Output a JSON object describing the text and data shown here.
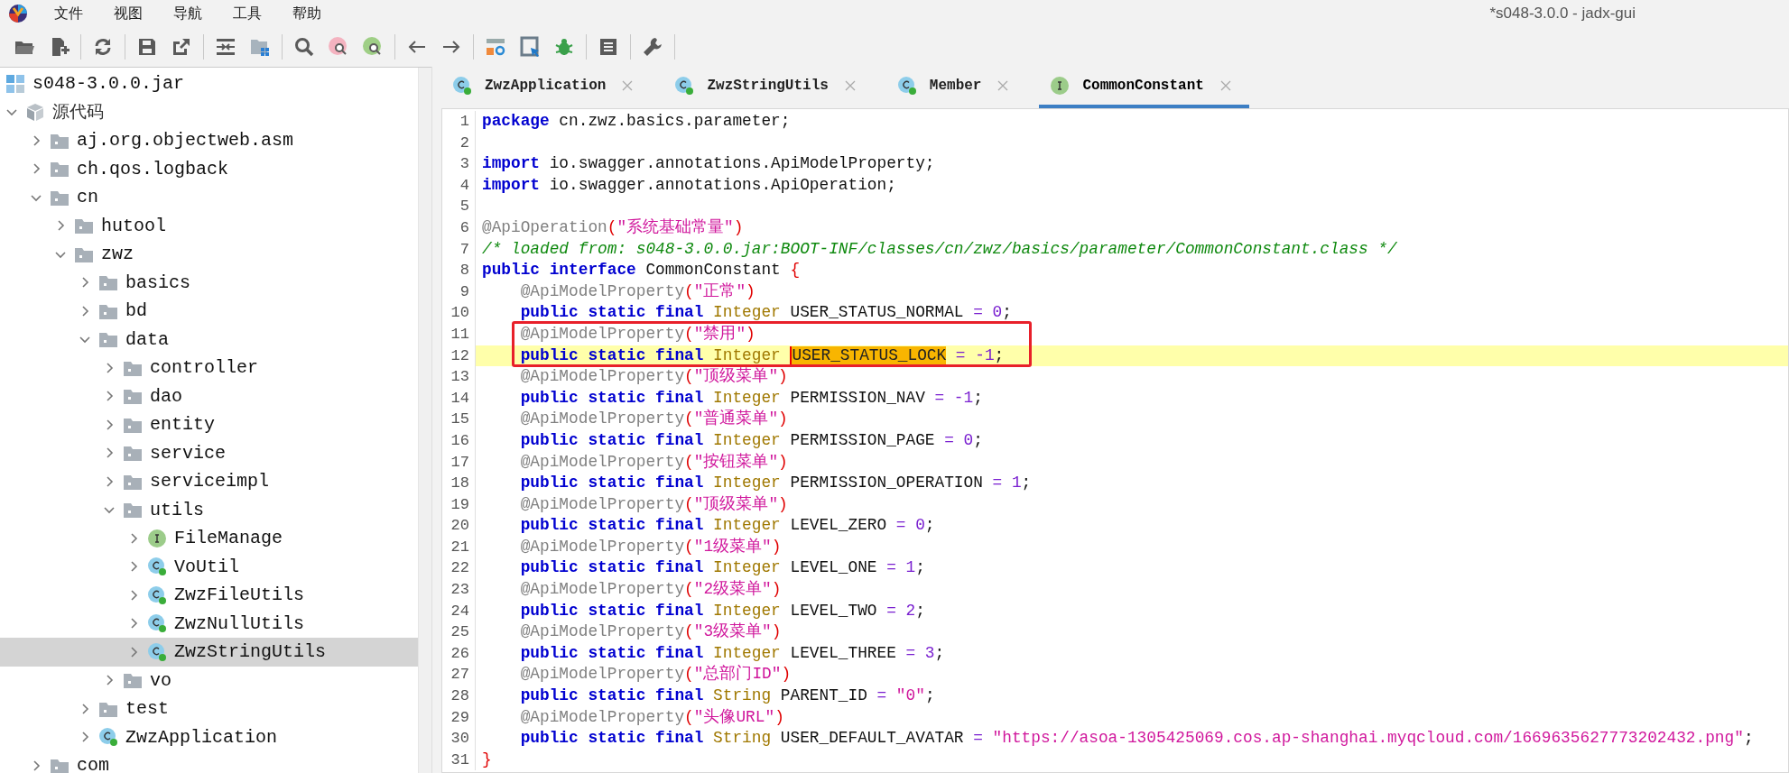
{
  "window": {
    "title": "*s048-3.0.0 - jadx-gui"
  },
  "menu": [
    "文件",
    "视图",
    "导航",
    "工具",
    "帮助"
  ],
  "tree": {
    "label": "s048-3.0.0.jar",
    "kind": "jar",
    "selected": false,
    "children": [
      {
        "label": "源代码",
        "kind": "source",
        "expanded": true,
        "selected": false,
        "children": [
          {
            "label": "aj.org.objectweb.asm",
            "kind": "folder",
            "expanded": false,
            "selected": false
          },
          {
            "label": "ch.qos.logback",
            "kind": "folder",
            "expanded": false,
            "selected": false
          },
          {
            "label": "cn",
            "kind": "folder",
            "expanded": true,
            "selected": false,
            "children": [
              {
                "label": "hutool",
                "kind": "folder",
                "expanded": false,
                "selected": false
              },
              {
                "label": "zwz",
                "kind": "folder",
                "expanded": true,
                "selected": false,
                "children": [
                  {
                    "label": "basics",
                    "kind": "folder",
                    "expanded": false,
                    "selected": false
                  },
                  {
                    "label": "bd",
                    "kind": "folder",
                    "expanded": false,
                    "selected": false
                  },
                  {
                    "label": "data",
                    "kind": "folder",
                    "expanded": true,
                    "selected": false,
                    "children": [
                      {
                        "label": "controller",
                        "kind": "folder",
                        "expanded": false,
                        "selected": false
                      },
                      {
                        "label": "dao",
                        "kind": "folder",
                        "expanded": false,
                        "selected": false
                      },
                      {
                        "label": "entity",
                        "kind": "folder",
                        "expanded": false,
                        "selected": false
                      },
                      {
                        "label": "service",
                        "kind": "folder",
                        "expanded": false,
                        "selected": false
                      },
                      {
                        "label": "serviceimpl",
                        "kind": "folder",
                        "expanded": false,
                        "selected": false
                      },
                      {
                        "label": "utils",
                        "kind": "folder",
                        "expanded": true,
                        "selected": false,
                        "children": [
                          {
                            "label": "FileManage",
                            "kind": "interface",
                            "expanded": false,
                            "selected": false
                          },
                          {
                            "label": "VoUtil",
                            "kind": "class",
                            "expanded": false,
                            "selected": false
                          },
                          {
                            "label": "ZwzFileUtils",
                            "kind": "class",
                            "expanded": false,
                            "selected": false
                          },
                          {
                            "label": "ZwzNullUtils",
                            "kind": "class",
                            "expanded": false,
                            "selected": false
                          },
                          {
                            "label": "ZwzStringUtils",
                            "kind": "class",
                            "expanded": false,
                            "selected": true
                          }
                        ]
                      },
                      {
                        "label": "vo",
                        "kind": "folder",
                        "expanded": false,
                        "selected": false
                      }
                    ]
                  },
                  {
                    "label": "test",
                    "kind": "folder",
                    "expanded": false,
                    "selected": false
                  },
                  {
                    "label": "ZwzApplication",
                    "kind": "class",
                    "expanded": false,
                    "selected": false
                  }
                ]
              }
            ]
          },
          {
            "label": "com",
            "kind": "folder",
            "expanded": false,
            "selected": false
          }
        ]
      }
    ]
  },
  "tabs": [
    {
      "label": "ZwzApplication",
      "kind": "class",
      "selected": false
    },
    {
      "label": "ZwzStringUtils",
      "kind": "class",
      "selected": false
    },
    {
      "label": "Member",
      "kind": "class",
      "selected": false
    },
    {
      "label": "CommonConstant",
      "kind": "interface",
      "selected": true
    }
  ],
  "code": [
    {
      "number": "1",
      "current": false,
      "tokens": [
        {
          "kind": "keyword",
          "text": "package"
        },
        {
          "kind": "plain",
          "text": " cn.zwz.basics.parameter;"
        }
      ]
    },
    {
      "number": "2",
      "current": false
    },
    {
      "number": "3",
      "current": false,
      "tokens": [
        {
          "kind": "keyword",
          "text": "import"
        },
        {
          "kind": "plain",
          "text": " io.swagger.annotations.ApiModelProperty;"
        }
      ]
    },
    {
      "number": "4",
      "current": false,
      "tokens": [
        {
          "kind": "keyword",
          "text": "import"
        },
        {
          "kind": "plain",
          "text": " io.swagger.annotations.ApiOperation;"
        }
      ]
    },
    {
      "number": "5",
      "current": false
    },
    {
      "number": "6",
      "current": false,
      "tokens": [
        {
          "kind": "annotation",
          "text": "@ApiOperation"
        },
        {
          "kind": "paren",
          "text": "("
        },
        {
          "kind": "string",
          "text": "\"系统基础常量\""
        },
        {
          "kind": "paren",
          "text": ")"
        }
      ]
    },
    {
      "number": "7",
      "current": false,
      "tokens": [
        {
          "kind": "comment",
          "text": "/* loaded from: s048-3.0.0.jar:BOOT-INF/classes/cn/zwz/basics/parameter/CommonConstant.class */"
        }
      ]
    },
    {
      "number": "8",
      "current": false,
      "tokens": [
        {
          "kind": "keyword",
          "text": "public interface"
        },
        {
          "kind": "plain",
          "text": " CommonConstant "
        },
        {
          "kind": "paren",
          "text": "{"
        }
      ]
    },
    {
      "number": "9",
      "current": false,
      "tokens": [
        {
          "kind": "annotation",
          "text": "    @ApiModelProperty"
        },
        {
          "kind": "paren",
          "text": "("
        },
        {
          "kind": "string",
          "text": "\"正常\""
        },
        {
          "kind": "paren",
          "text": ")"
        }
      ]
    },
    {
      "number": "10",
      "current": false,
      "tokens": [
        {
          "kind": "keyword",
          "text": "    public static final"
        },
        {
          "kind": "type",
          "text": " Integer"
        },
        {
          "kind": "plain",
          "text": " USER_STATUS_NORMAL "
        },
        {
          "kind": "operator",
          "text": "="
        },
        {
          "kind": "number",
          "text": " 0"
        },
        {
          "kind": "plain",
          "text": ";"
        }
      ]
    },
    {
      "number": "11",
      "current": false,
      "tokens": [
        {
          "kind": "annotation",
          "text": "    @ApiModelProperty"
        },
        {
          "kind": "paren",
          "text": "("
        },
        {
          "kind": "string",
          "text": "\"禁用\""
        },
        {
          "kind": "paren",
          "text": ")"
        }
      ]
    },
    {
      "number": "12",
      "current": true,
      "tokens": [
        {
          "kind": "keyword",
          "text": "    public static final"
        },
        {
          "kind": "type",
          "text": " Integer "
        },
        {
          "kind": "match",
          "text": "USER_STATUS_LOCK"
        },
        {
          "kind": "operator",
          "text": " ="
        },
        {
          "kind": "number",
          "text": " -1"
        },
        {
          "kind": "plain",
          "text": ";"
        }
      ]
    },
    {
      "number": "13",
      "current": false,
      "tokens": [
        {
          "kind": "annotation",
          "text": "    @ApiModelProperty"
        },
        {
          "kind": "paren",
          "text": "("
        },
        {
          "kind": "string",
          "text": "\"顶级菜单\""
        },
        {
          "kind": "paren",
          "text": ")"
        }
      ]
    },
    {
      "number": "14",
      "current": false,
      "tokens": [
        {
          "kind": "keyword",
          "text": "    public static final"
        },
        {
          "kind": "type",
          "text": " Integer"
        },
        {
          "kind": "plain",
          "text": " PERMISSION_NAV "
        },
        {
          "kind": "operator",
          "text": "="
        },
        {
          "kind": "number",
          "text": " -1"
        },
        {
          "kind": "plain",
          "text": ";"
        }
      ]
    },
    {
      "number": "15",
      "current": false,
      "tokens": [
        {
          "kind": "annotation",
          "text": "    @ApiModelProperty"
        },
        {
          "kind": "paren",
          "text": "("
        },
        {
          "kind": "string",
          "text": "\"普通菜单\""
        },
        {
          "kind": "paren",
          "text": ")"
        }
      ]
    },
    {
      "number": "16",
      "current": false,
      "tokens": [
        {
          "kind": "keyword",
          "text": "    public static final"
        },
        {
          "kind": "type",
          "text": " Integer"
        },
        {
          "kind": "plain",
          "text": " PERMISSION_PAGE "
        },
        {
          "kind": "operator",
          "text": "="
        },
        {
          "kind": "number",
          "text": " 0"
        },
        {
          "kind": "plain",
          "text": ";"
        }
      ]
    },
    {
      "number": "17",
      "current": false,
      "tokens": [
        {
          "kind": "annotation",
          "text": "    @ApiModelProperty"
        },
        {
          "kind": "paren",
          "text": "("
        },
        {
          "kind": "string",
          "text": "\"按钮菜单\""
        },
        {
          "kind": "paren",
          "text": ")"
        }
      ]
    },
    {
      "number": "18",
      "current": false,
      "tokens": [
        {
          "kind": "keyword",
          "text": "    public static final"
        },
        {
          "kind": "type",
          "text": " Integer"
        },
        {
          "kind": "plain",
          "text": " PERMISSION_OPERATION "
        },
        {
          "kind": "operator",
          "text": "="
        },
        {
          "kind": "number",
          "text": " 1"
        },
        {
          "kind": "plain",
          "text": ";"
        }
      ]
    },
    {
      "number": "19",
      "current": false,
      "tokens": [
        {
          "kind": "annotation",
          "text": "    @ApiModelProperty"
        },
        {
          "kind": "paren",
          "text": "("
        },
        {
          "kind": "string",
          "text": "\"顶级菜单\""
        },
        {
          "kind": "paren",
          "text": ")"
        }
      ]
    },
    {
      "number": "20",
      "current": false,
      "tokens": [
        {
          "kind": "keyword",
          "text": "    public static final"
        },
        {
          "kind": "type",
          "text": " Integer"
        },
        {
          "kind": "plain",
          "text": " LEVEL_ZERO "
        },
        {
          "kind": "operator",
          "text": "="
        },
        {
          "kind": "number",
          "text": " 0"
        },
        {
          "kind": "plain",
          "text": ";"
        }
      ]
    },
    {
      "number": "21",
      "current": false,
      "tokens": [
        {
          "kind": "annotation",
          "text": "    @ApiModelProperty"
        },
        {
          "kind": "paren",
          "text": "("
        },
        {
          "kind": "string",
          "text": "\"1级菜单\""
        },
        {
          "kind": "paren",
          "text": ")"
        }
      ]
    },
    {
      "number": "22",
      "current": false,
      "tokens": [
        {
          "kind": "keyword",
          "text": "    public static final"
        },
        {
          "kind": "type",
          "text": " Integer"
        },
        {
          "kind": "plain",
          "text": " LEVEL_ONE "
        },
        {
          "kind": "operator",
          "text": "="
        },
        {
          "kind": "number",
          "text": " 1"
        },
        {
          "kind": "plain",
          "text": ";"
        }
      ]
    },
    {
      "number": "23",
      "current": false,
      "tokens": [
        {
          "kind": "annotation",
          "text": "    @ApiModelProperty"
        },
        {
          "kind": "paren",
          "text": "("
        },
        {
          "kind": "string",
          "text": "\"2级菜单\""
        },
        {
          "kind": "paren",
          "text": ")"
        }
      ]
    },
    {
      "number": "24",
      "current": false,
      "tokens": [
        {
          "kind": "keyword",
          "text": "    public static final"
        },
        {
          "kind": "type",
          "text": " Integer"
        },
        {
          "kind": "plain",
          "text": " LEVEL_TWO "
        },
        {
          "kind": "operator",
          "text": "="
        },
        {
          "kind": "number",
          "text": " 2"
        },
        {
          "kind": "plain",
          "text": ";"
        }
      ]
    },
    {
      "number": "25",
      "current": false,
      "tokens": [
        {
          "kind": "annotation",
          "text": "    @ApiModelProperty"
        },
        {
          "kind": "paren",
          "text": "("
        },
        {
          "kind": "string",
          "text": "\"3级菜单\""
        },
        {
          "kind": "paren",
          "text": ")"
        }
      ]
    },
    {
      "number": "26",
      "current": false,
      "tokens": [
        {
          "kind": "keyword",
          "text": "    public static final"
        },
        {
          "kind": "type",
          "text": " Integer"
        },
        {
          "kind": "plain",
          "text": " LEVEL_THREE "
        },
        {
          "kind": "operator",
          "text": "="
        },
        {
          "kind": "number",
          "text": " 3"
        },
        {
          "kind": "plain",
          "text": ";"
        }
      ]
    },
    {
      "number": "27",
      "current": false,
      "tokens": [
        {
          "kind": "annotation",
          "text": "    @ApiModelProperty"
        },
        {
          "kind": "paren",
          "text": "("
        },
        {
          "kind": "string",
          "text": "\"总部门ID\""
        },
        {
          "kind": "paren",
          "text": ")"
        }
      ]
    },
    {
      "number": "28",
      "current": false,
      "tokens": [
        {
          "kind": "keyword",
          "text": "    public static final"
        },
        {
          "kind": "type",
          "text": " String"
        },
        {
          "kind": "plain",
          "text": " PARENT_ID "
        },
        {
          "kind": "operator",
          "text": "= "
        },
        {
          "kind": "string",
          "text": "\"0\""
        },
        {
          "kind": "plain",
          "text": ";"
        }
      ]
    },
    {
      "number": "29",
      "current": false,
      "tokens": [
        {
          "kind": "annotation",
          "text": "    @ApiModelProperty"
        },
        {
          "kind": "paren",
          "text": "("
        },
        {
          "kind": "string",
          "text": "\"头像URL\""
        },
        {
          "kind": "paren",
          "text": ")"
        }
      ]
    },
    {
      "number": "30",
      "current": false,
      "tokens": [
        {
          "kind": "keyword",
          "text": "    public static final"
        },
        {
          "kind": "type",
          "text": " String"
        },
        {
          "kind": "plain",
          "text": " USER_DEFAULT_AVATAR "
        },
        {
          "kind": "operator",
          "text": "= "
        },
        {
          "kind": "string",
          "text": "\"https://asoa-1305425069.cos.ap-shanghai.myqcloud.com/1669635627773202432.png\""
        },
        {
          "kind": "plain",
          "text": ";"
        }
      ]
    },
    {
      "number": "31",
      "current": false,
      "tokens": [
        {
          "kind": "paren",
          "text": "}"
        }
      ]
    }
  ]
}
